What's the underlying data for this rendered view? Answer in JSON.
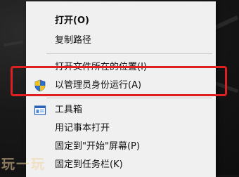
{
  "menu": {
    "items": [
      {
        "label": "打开(O)"
      },
      {
        "label": "复制路径"
      },
      {
        "label": "打开文件所在的位置(I)"
      },
      {
        "label": "以管理员身份运行(A)"
      },
      {
        "label": "工具箱"
      },
      {
        "label": "用记事本打开"
      },
      {
        "label": "固定到\"开始\"屏幕(P)"
      },
      {
        "label": "固定到任务栏(K)"
      }
    ]
  },
  "watermark": {
    "text": "玩一玩"
  },
  "colors": {
    "menu_bg": "#f0f0f0",
    "highlight": "#e02020",
    "shield_blue": "#2a6fd6",
    "shield_yellow": "#f2c318"
  },
  "icons": {
    "run_as_admin": "uac-shield-icon",
    "toolbox": "toolbox-icon"
  }
}
